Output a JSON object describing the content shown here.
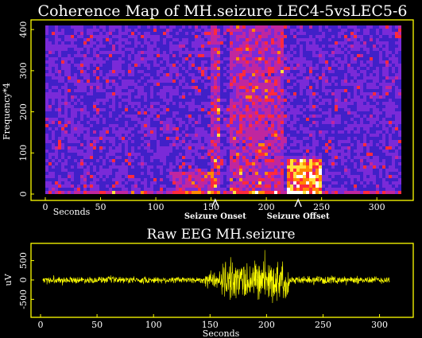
{
  "chart_data": [
    {
      "type": "heatmap",
      "title": "Coherence Map of MH.seizure LEC4-5vsLEC5-6",
      "xlabel": "Seconds",
      "ylabel": "Frequency*4",
      "xlim": [
        0,
        320
      ],
      "ylim": [
        0,
        410
      ],
      "x_ticks": [
        "0",
        "50",
        "100",
        "150",
        "200",
        "250",
        "300"
      ],
      "y_ticks": [
        "0",
        "100",
        "200",
        "300",
        "400"
      ],
      "colormap": [
        "#000000",
        "#1b0d8f",
        "#4020c8",
        "#7a2ad8",
        "#c0269f",
        "#ff2a3c",
        "#ff8a00",
        "#ffe23a",
        "#ffffff"
      ],
      "annotations": [
        {
          "label": "Seizure Onset",
          "x": 143
        },
        {
          "label": "Seizure Offset",
          "x": 218
        }
      ],
      "high_coherence_regions": [
        {
          "x": [
            218,
            248
          ],
          "y": [
            0,
            90
          ],
          "level": "high"
        },
        {
          "x": [
            165,
            215
          ],
          "y": [
            0,
            410
          ],
          "level": "moderate"
        },
        {
          "x": [
            148,
            158
          ],
          "y": [
            0,
            410
          ],
          "level": "moderate"
        },
        {
          "x": [
            115,
            150
          ],
          "y": [
            0,
            60
          ],
          "level": "moderate"
        }
      ]
    },
    {
      "type": "line",
      "title": "Raw EEG MH.seizure",
      "xlabel": "Seconds",
      "ylabel": "uV",
      "xlim": [
        0,
        320
      ],
      "ylim": [
        -800,
        800
      ],
      "x_ticks": [
        "0",
        "50",
        "100",
        "150",
        "200",
        "250",
        "300"
      ],
      "y_ticks": [
        "-500",
        "0",
        "500"
      ],
      "series_color": "#ffff00",
      "envelope": [
        {
          "x": [
            0,
            145
          ],
          "amplitude": 100
        },
        {
          "x": [
            145,
            160
          ],
          "amplitude": 250
        },
        {
          "x": [
            160,
            220
          ],
          "amplitude": 600
        },
        {
          "x": [
            220,
            320
          ],
          "amplitude": 110
        }
      ]
    }
  ],
  "colors": {
    "background": "#000000",
    "axis_yellow": "#ffff00",
    "text": "#ffffff"
  }
}
